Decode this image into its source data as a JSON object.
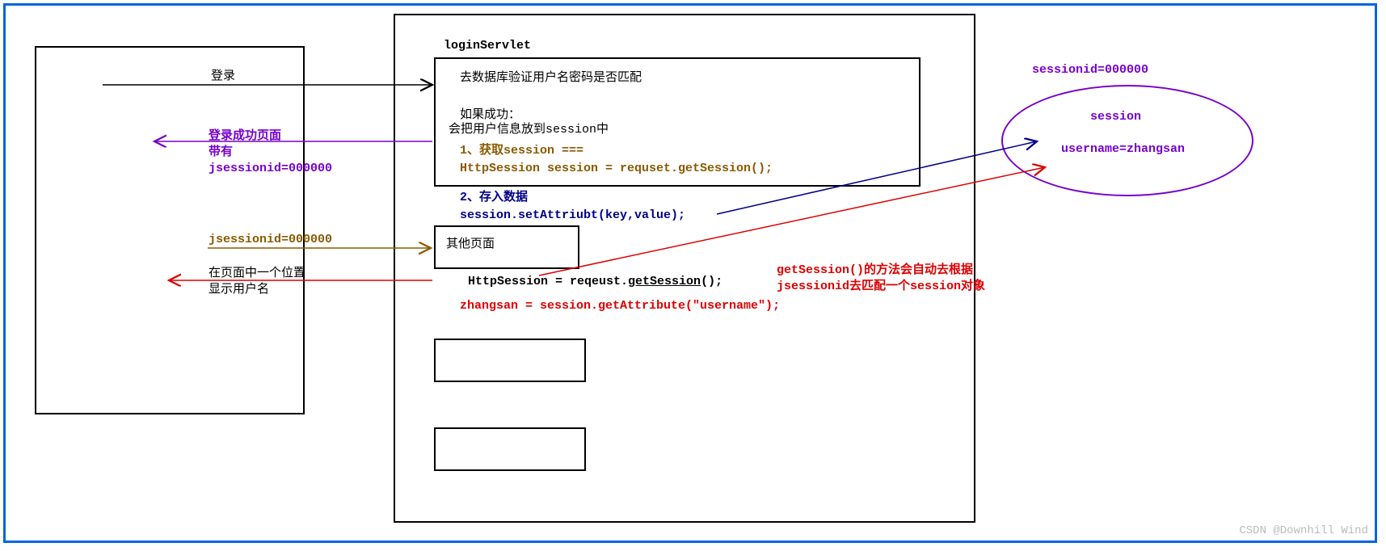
{
  "client": {
    "loginLabel": "登录",
    "loginSuccess": "登录成功页面",
    "with": "带有",
    "jsessionCookie": "jsessionid=000000",
    "jsessionCookie2": "jsessionid=000000",
    "pagePosition": "在页面中一个位置",
    "showUsername": "显示用户名"
  },
  "servlet": {
    "title": "loginServlet",
    "verify": "去数据库验证用户名密码是否匹配",
    "ifSuccess": "如果成功：",
    "putInSession": "会把用户信息放到session中",
    "step1": "1、获取session ===",
    "getSession": "HttpSession session = requset.getSession();",
    "step2": "2、存入数据",
    "setAttr": "session.setAttriubt(key,value);",
    "otherPage": "其他页面",
    "otherGetSession1": "HttpSession = reqeust.",
    "otherGetSession2": "getSession",
    "otherGetSession3": "();",
    "getAttr": "zhangsan = session.getAttribute(\"username\");"
  },
  "session": {
    "sessionId": "sessionid=000000",
    "sessionLabel": "session",
    "username": "username=zhangsan"
  },
  "note": {
    "line1": "getSession()的方法会自动去根据",
    "line2": "jsessionid去匹配一个session对象"
  },
  "watermark": "CSDN @Downhill Wind"
}
